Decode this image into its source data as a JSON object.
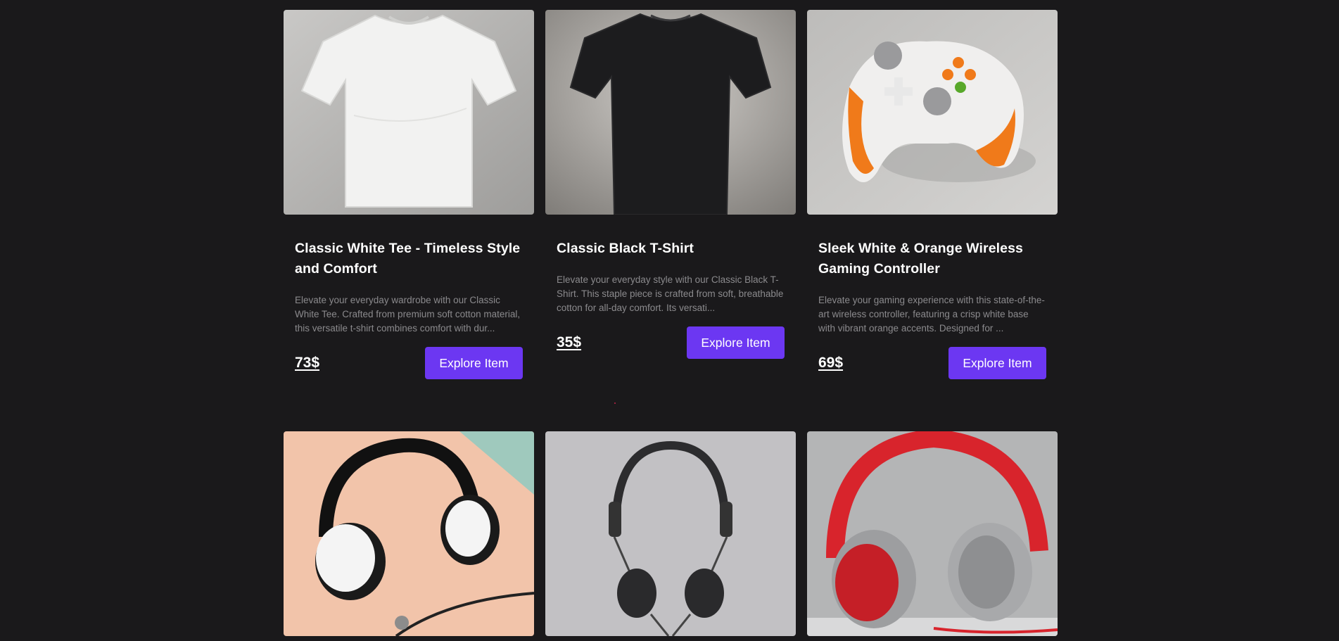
{
  "products": [
    {
      "title": "Classic White Tee - Timeless Style and Comfort",
      "description": "Elevate your everyday wardrobe with our Classic White Tee. Crafted from premium soft cotton material, this versatile t-shirt combines comfort with dur...",
      "price": "73$",
      "button": "Explore Item",
      "image": "white-tshirt"
    },
    {
      "title": "Classic Black T-Shirt",
      "description": "Elevate your everyday style with our Classic Black T-Shirt. This staple piece is crafted from soft, breathable cotton for all-day comfort. Its versati...",
      "price": "35$",
      "button": "Explore Item",
      "image": "black-tshirt"
    },
    {
      "title": "Sleek White & Orange Wireless Gaming Controller",
      "description": "Elevate your gaming experience with this state-of-the-art wireless controller, featuring a crisp white base with vibrant orange accents. Designed for ...",
      "price": "69$",
      "button": "Explore Item",
      "image": "game-controller"
    },
    {
      "image": "white-headphones"
    },
    {
      "image": "black-headphones"
    },
    {
      "image": "red-headphones"
    }
  ],
  "colors": {
    "background": "#1a191b",
    "accent": "#6c37f2",
    "muted_text": "#8b8a8d"
  }
}
